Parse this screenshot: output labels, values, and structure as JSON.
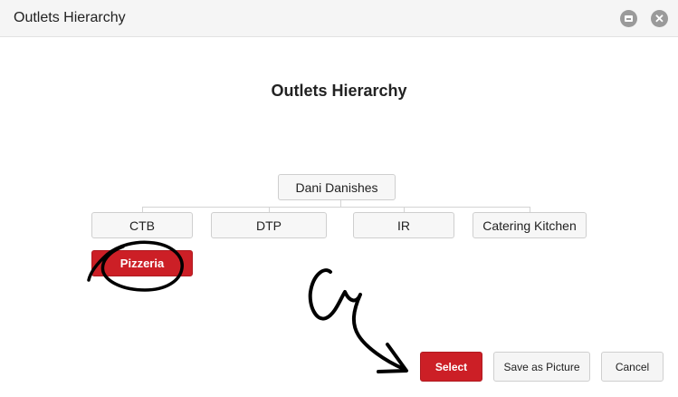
{
  "window": {
    "title": "Outlets Hierarchy",
    "maximize_icon": "window-maximize-icon",
    "close_icon": "close-icon",
    "close_glyph": "✕"
  },
  "content": {
    "heading": "Outlets Hierarchy"
  },
  "hierarchy": {
    "root": "Dani Danishes",
    "children": [
      "CTB",
      "DTP",
      "IR",
      "Catering Kitchen"
    ],
    "grandchild": "Pizzeria",
    "selected": "Pizzeria"
  },
  "actions": {
    "select_label": "Select",
    "save_picture_label": "Save as Picture",
    "cancel_label": "Cancel"
  },
  "colors": {
    "accent": "#cc1f26",
    "annotation": "#000000"
  }
}
